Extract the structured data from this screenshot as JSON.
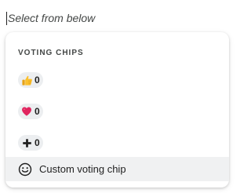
{
  "search": {
    "placeholder": "Select from below"
  },
  "dropdown": {
    "section_header": "VOTING CHIPS",
    "chips": [
      {
        "icon": "thumbs-up-icon",
        "count": "0"
      },
      {
        "icon": "red-heart-icon",
        "count": "0"
      },
      {
        "icon": "plus-icon",
        "count": "0"
      }
    ],
    "custom": {
      "icon": "smiley-face-icon",
      "label": "Custom voting chip"
    }
  },
  "colors": {
    "chip_background": "#eceef0",
    "hover_row": "#f0f1f2",
    "heart": "#e0245e",
    "thumb": "#f4b400"
  }
}
